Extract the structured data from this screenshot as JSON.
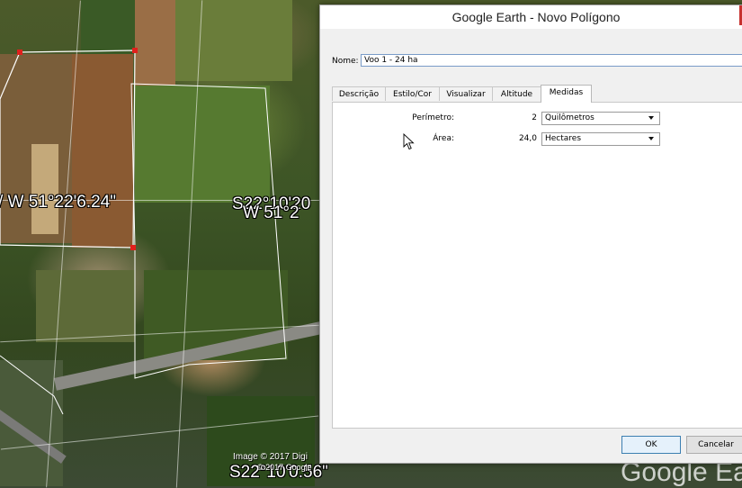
{
  "map": {
    "coords": {
      "lon_left": "/ W 51°22'6.24\"",
      "lat_mid": "S22°10'20",
      "lon_mid": "W 51°2",
      "lat_bottom": "S22°10'0.56\""
    },
    "imagery_credit": "Image © 2017 Digi",
    "imagery_credit2": "© 2017 Google",
    "logo_text": "Google Ea"
  },
  "dialog": {
    "title": "Google Earth - Novo Polígono",
    "name_label": "Nome:",
    "name_value": "Voo 1 - 24 ha",
    "tabs": [
      {
        "label": "Descrição"
      },
      {
        "label": "Estilo/Cor"
      },
      {
        "label": "Visualizar"
      },
      {
        "label": "Altitude"
      },
      {
        "label": "Medidas"
      }
    ],
    "active_tab": "Medidas",
    "measures": {
      "perimeter": {
        "label": "Perímetro:",
        "value": "2",
        "unit": "Quilômetros"
      },
      "area": {
        "label": "Área:",
        "value": "24,0",
        "unit": "Hectares"
      }
    },
    "ok_label": "OK",
    "cancel_label": "Cancelar"
  },
  "colors": {
    "polygon_vertex": "#e0201c",
    "close_button": "#c7312f",
    "focus_border": "#3c7fb1"
  }
}
